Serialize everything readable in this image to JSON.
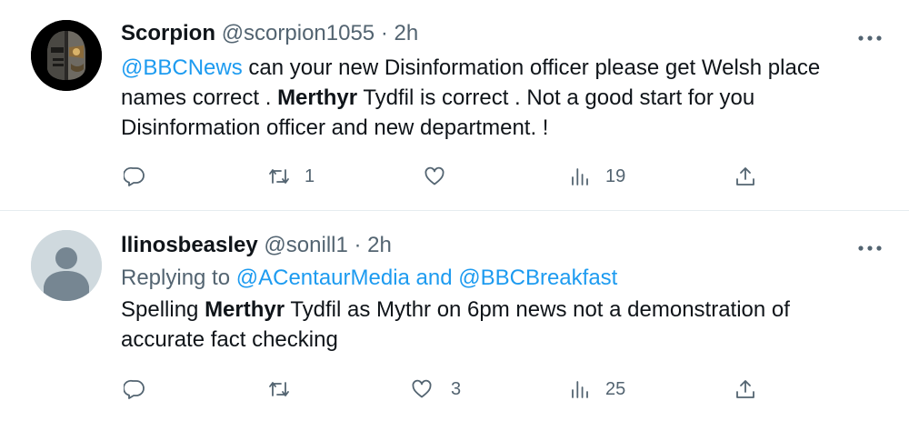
{
  "tweets": [
    {
      "name": "Scorpion",
      "handle": "@scorpion1055",
      "separator": "·",
      "time": "2h",
      "text_parts": [
        "@BBCNews",
        " can your new Disinformation officer please get Welsh place names correct . ",
        "Merthyr",
        " Tydfil is correct . Not a good start for you Disinformation officer  and new department.  !"
      ],
      "counts": {
        "replies": "",
        "retweets": "1",
        "likes": "",
        "views": "19"
      }
    },
    {
      "name": "llinosbeasley",
      "handle": "@sonill1",
      "separator": "·",
      "time": "2h",
      "replying_prefix": "Replying to ",
      "replying_to": "@ACentaurMedia and @BBCBreakfast",
      "text_parts": [
        "Spelling ",
        "Merthyr",
        " Tydfil as Mythr on 6pm news not a demonstration of accurate fact checking"
      ],
      "counts": {
        "replies": "",
        "retweets": "",
        "likes": "3",
        "views": "25"
      }
    }
  ],
  "icons": {
    "more": "more-horizontal-icon",
    "reply": "reply-icon",
    "retweet": "retweet-icon",
    "like": "heart-icon",
    "views": "views-icon",
    "share": "share-icon",
    "avatar_default": "default-avatar-icon"
  },
  "colors": {
    "link": "#1d9bf0",
    "secondary": "#536471",
    "text": "#0f1419",
    "divider": "#e6ecf0"
  }
}
